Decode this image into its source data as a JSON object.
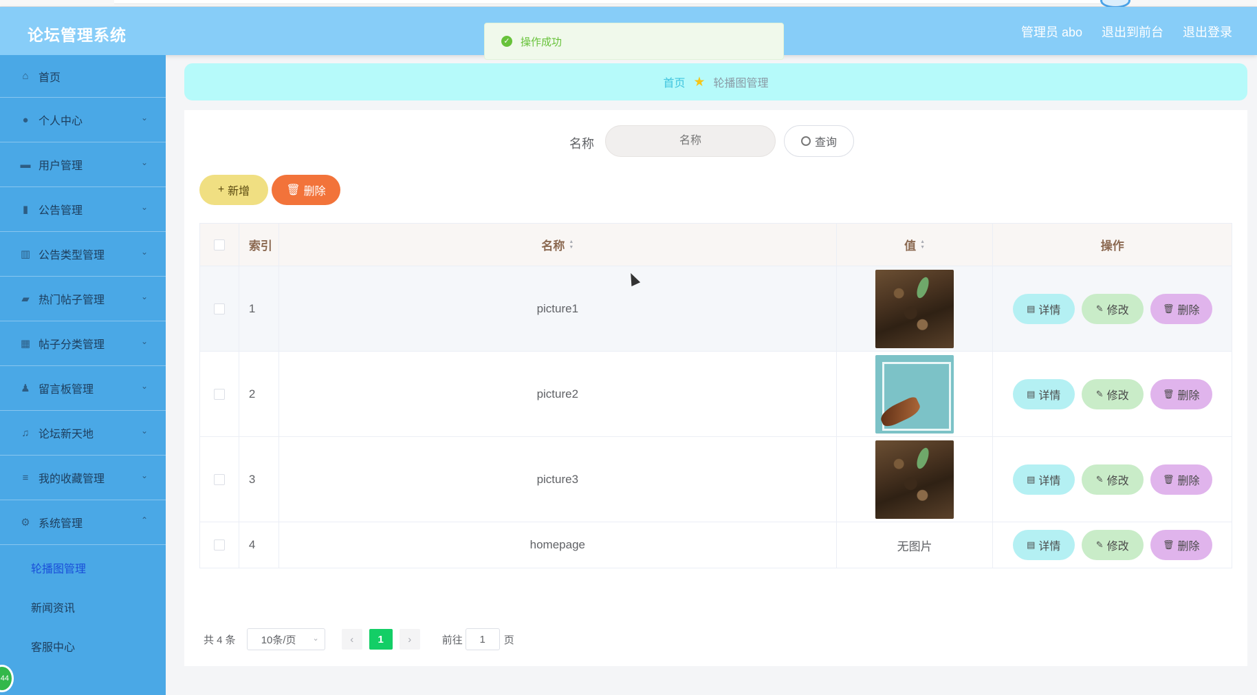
{
  "header": {
    "title": "论坛管理系统",
    "admin": "管理员 abo",
    "to_front": "退出到前台",
    "logout": "退出登录"
  },
  "toast": {
    "message": "操作成功"
  },
  "sidebar": {
    "items": [
      {
        "label": "首页",
        "icon": "home-icon"
      },
      {
        "label": "个人中心",
        "icon": "user-icon"
      },
      {
        "label": "用户管理",
        "icon": "id-card-icon"
      },
      {
        "label": "公告管理",
        "icon": "book-icon"
      },
      {
        "label": "公告类型管理",
        "icon": "bar-chart-icon"
      },
      {
        "label": "热门帖子管理",
        "icon": "message-icon"
      },
      {
        "label": "帖子分类管理",
        "icon": "grid-icon"
      },
      {
        "label": "留言板管理",
        "icon": "person-icon"
      },
      {
        "label": "论坛新天地",
        "icon": "microphone-icon"
      },
      {
        "label": "我的收藏管理",
        "icon": "list-icon"
      },
      {
        "label": "系统管理",
        "icon": "gear-icon"
      }
    ],
    "sub_items": [
      "轮播图管理",
      "新闻资讯",
      "客服中心"
    ]
  },
  "breadcrumb": {
    "home": "首页",
    "current": "轮播图管理"
  },
  "search": {
    "label": "名称",
    "placeholder": "名称",
    "button": "查询"
  },
  "actions": {
    "add": "新增",
    "delete": "删除"
  },
  "table": {
    "headers": {
      "index": "索引",
      "name": "名称",
      "value": "值",
      "ops": "操作"
    },
    "rows": [
      {
        "index": "1",
        "name": "picture1",
        "value_type": "image"
      },
      {
        "index": "2",
        "name": "picture2",
        "value_type": "image"
      },
      {
        "index": "3",
        "name": "picture3",
        "value_type": "image"
      },
      {
        "index": "4",
        "name": "homepage",
        "value_type": "text",
        "value_text": "无图片"
      }
    ],
    "ops": {
      "detail": "详情",
      "edit": "修改",
      "delete": "删除"
    }
  },
  "pagination": {
    "total": "共 4 条",
    "page_size": "10条/页",
    "current_page": "1",
    "goto_label": "前往",
    "goto_value": "1",
    "goto_suffix": "页"
  },
  "float_badge": "44"
}
